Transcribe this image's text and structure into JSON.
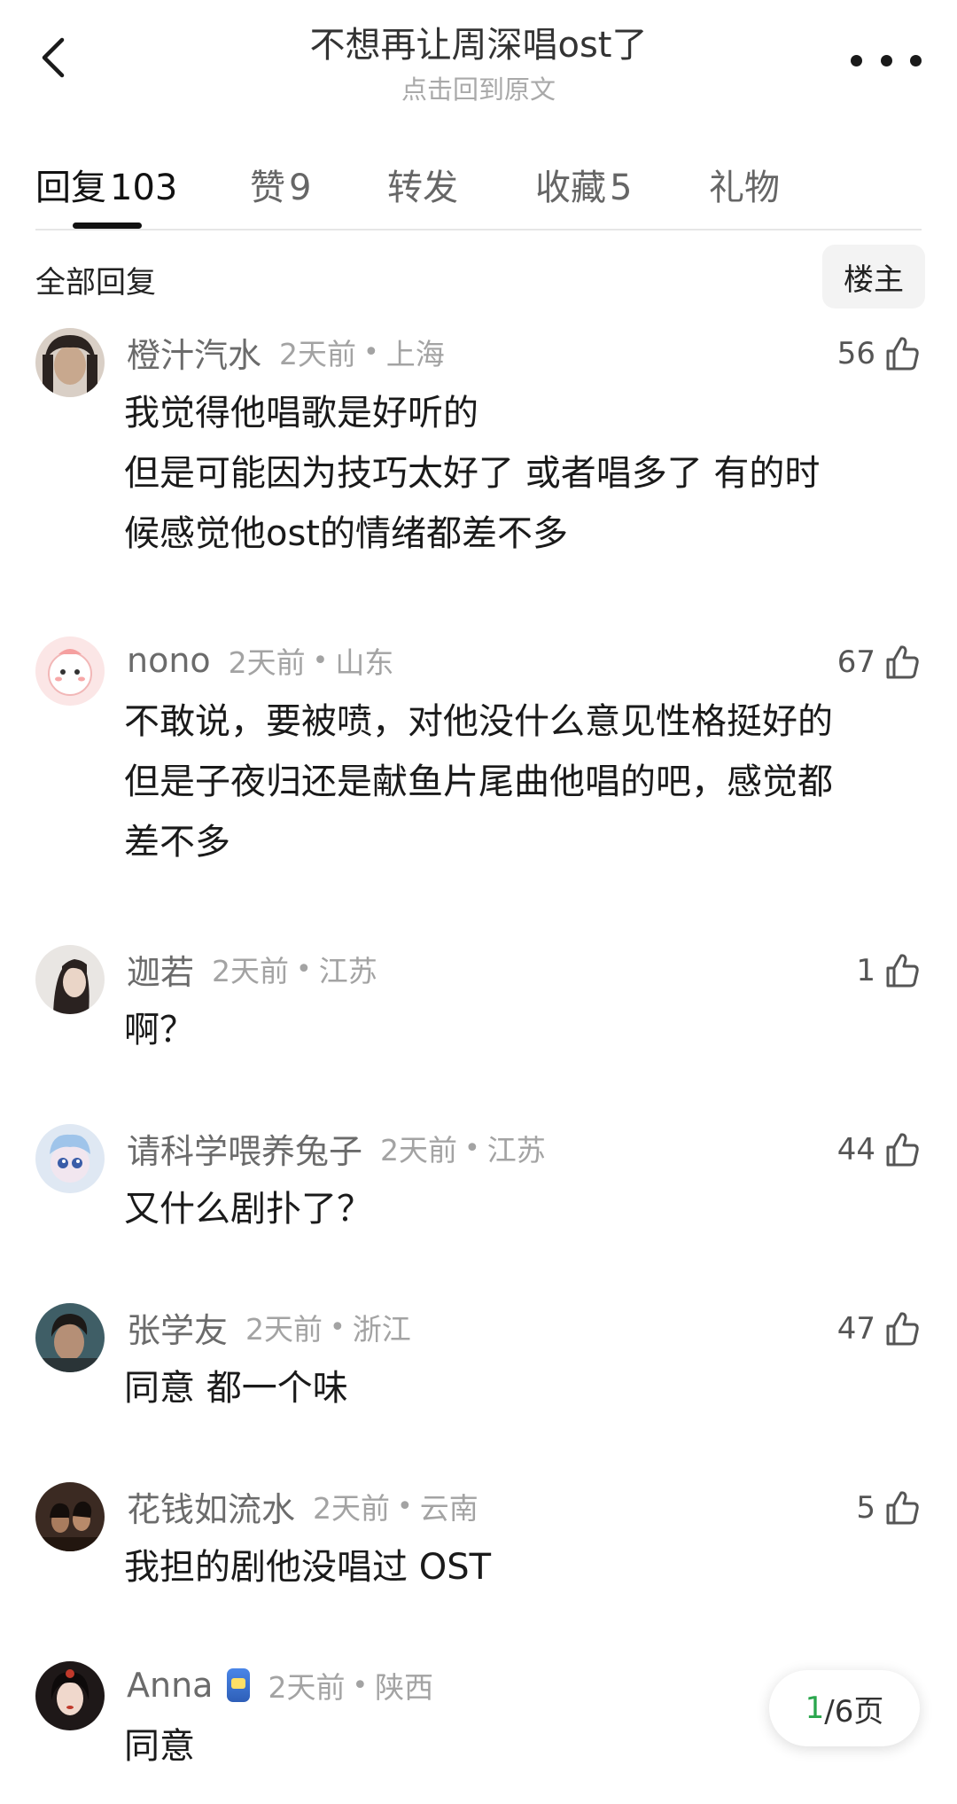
{
  "header": {
    "title": "不想再让周深唱ost了",
    "subtitle": "点击回到原文",
    "back_icon": "chevron-left-icon",
    "more_icon": "more-horizontal-icon"
  },
  "tabs": [
    {
      "label": "回复",
      "count": "103",
      "active": true
    },
    {
      "label": "赞",
      "count": "9"
    },
    {
      "label": "转发",
      "count": ""
    },
    {
      "label": "收藏",
      "count": "5"
    },
    {
      "label": "礼物",
      "count": ""
    }
  ],
  "section": {
    "title": "全部回复",
    "filter_button": "楼主"
  },
  "comments": [
    {
      "user": "橙汁汽水",
      "time": "2天前",
      "location": "上海",
      "likes": "56",
      "text": [
        "我觉得他唱歌是好听的",
        "但是可能因为技巧太好了 或者唱多了 有的时",
        "候感觉他ost的情绪都差不多"
      ]
    },
    {
      "user": "nono",
      "time": "2天前",
      "location": "山东",
      "likes": "67",
      "text": [
        "不敢说，要被喷，对他没什么意见性格挺好的",
        "但是子夜归还是献鱼片尾曲他唱的吧，感觉都",
        "差不多"
      ]
    },
    {
      "user": "迦若",
      "time": "2天前",
      "location": "江苏",
      "likes": "1",
      "text": [
        "啊？"
      ]
    },
    {
      "user": "请科学喂养兔子",
      "time": "2天前",
      "location": "江苏",
      "likes": "44",
      "text": [
        "又什么剧扑了？"
      ]
    },
    {
      "user": "张学友",
      "time": "2天前",
      "location": "浙江",
      "likes": "47",
      "text": [
        "同意 都一个味"
      ]
    },
    {
      "user": "花钱如流水",
      "time": "2天前",
      "location": "云南",
      "likes": "5",
      "text": [
        "我担的剧他没唱过 OST"
      ]
    },
    {
      "user": "Anna",
      "time": "2天前",
      "location": "陕西",
      "likes": "",
      "text": [
        "同意"
      ]
    }
  ],
  "pager": {
    "current": "1",
    "total": "/6页"
  },
  "colors": {
    "accent_green": "#2aa64d",
    "muted_gray": "#a3a3a3",
    "name_gray": "#6b6b6b"
  }
}
